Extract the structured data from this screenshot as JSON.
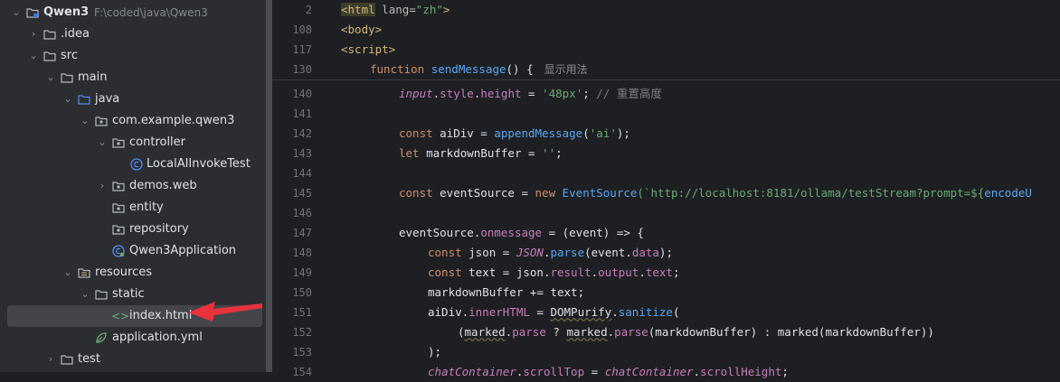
{
  "tree": {
    "root": {
      "label": "Qwen3",
      "path": "F:\\coded\\java\\Qwen3"
    },
    "items": [
      {
        "label": ".idea"
      },
      {
        "label": "src"
      },
      {
        "label": "main"
      },
      {
        "label": "java"
      },
      {
        "label": "com.example.qwen3"
      },
      {
        "label": "controller"
      },
      {
        "label": "LocalAIInvokeTest"
      },
      {
        "label": "demos.web"
      },
      {
        "label": "entity"
      },
      {
        "label": "repository"
      },
      {
        "label": "Qwen3Application"
      },
      {
        "label": "resources"
      },
      {
        "label": "static"
      },
      {
        "label": "index.html"
      },
      {
        "label": "application.yml"
      },
      {
        "label": "test"
      }
    ]
  },
  "sticky": [
    {
      "line": "2",
      "parts": [
        "<html",
        " lang=",
        "\"zh\"",
        ">"
      ]
    },
    {
      "line": "108",
      "text": "<body>"
    },
    {
      "line": "117",
      "text": "<script>"
    },
    {
      "line": "130",
      "parts": [
        "function ",
        "sendMessage",
        "() {"
      ],
      "hint": "显示用法"
    }
  ],
  "lines": [
    {
      "n": "140",
      "parts": [
        "input",
        ".",
        "style",
        ".",
        "height",
        " = ",
        "'48px'",
        "; ",
        "// 重置高度"
      ]
    },
    {
      "n": "141"
    },
    {
      "n": "142",
      "parts": [
        "const ",
        "aiDiv = ",
        "appendMessage",
        "(",
        "'ai'",
        ");"
      ]
    },
    {
      "n": "143",
      "parts": [
        "let ",
        "markdownBuffer = ",
        "''",
        ";"
      ]
    },
    {
      "n": "144"
    },
    {
      "n": "145",
      "parts": [
        "const ",
        "eventSource = ",
        "new ",
        "EventSource",
        "(`http://localhost:8181/ollama/testStream?prompt=${",
        "encodeU"
      ]
    },
    {
      "n": "146"
    },
    {
      "n": "147",
      "parts": [
        "eventSource.",
        "onmessage",
        " = (event) => {"
      ]
    },
    {
      "n": "148",
      "parts": [
        "const ",
        "json = ",
        "JSON",
        ".",
        "parse",
        "(event.",
        "data",
        ");"
      ]
    },
    {
      "n": "149",
      "parts": [
        "const ",
        "text = json.",
        "result",
        ".",
        "output",
        ".",
        "text",
        ";"
      ]
    },
    {
      "n": "150",
      "parts": [
        "markdownBuffer += text;"
      ]
    },
    {
      "n": "151",
      "parts": [
        "aiDiv.",
        "innerHTML",
        " = ",
        "DOMPurify",
        ".",
        "sanitize",
        "("
      ]
    },
    {
      "n": "152",
      "parts": [
        "(",
        "marked",
        ".",
        "parse",
        " ? ",
        "marked",
        ".",
        "parse",
        "(",
        "markdownBuffer",
        ") : ",
        "marked",
        "(",
        "markdownBuffer",
        "))"
      ]
    },
    {
      "n": "153",
      "parts": [
        ");"
      ]
    },
    {
      "n": "154",
      "parts": [
        "chatContainer",
        ".",
        "scrollTop",
        " = ",
        "chatContainer",
        ".",
        "scrollHeight",
        ";"
      ]
    }
  ],
  "colors": {
    "sidebar": "#2b2d30",
    "editor": "#1e1f22",
    "selection": "#43454a",
    "arrow": "#e8323c",
    "keyword": "#cf8e6d",
    "string": "#6aab73",
    "function": "#56a8f5",
    "property": "#c77dbb"
  }
}
